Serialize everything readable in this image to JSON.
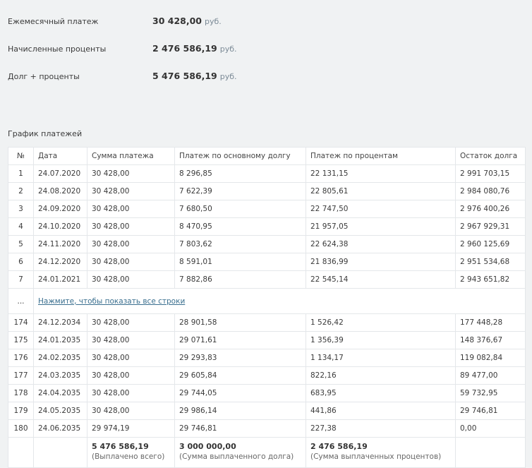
{
  "summary": [
    {
      "label": "Ежемесячный платеж",
      "value": "30 428,00",
      "unit": "руб."
    },
    {
      "label": "Начисленные проценты",
      "value": "2 476 586,19",
      "unit": "руб."
    },
    {
      "label": "Долг + проценты",
      "value": "5 476 586,19",
      "unit": "руб."
    }
  ],
  "schedule": {
    "title": "График платежей",
    "headers": [
      "№",
      "Дата",
      "Сумма платежа",
      "Платеж по основному долгу",
      "Платеж по процентам",
      "Остаток долга"
    ],
    "rows_top": [
      [
        "1",
        "24.07.2020",
        "30 428,00",
        "8 296,85",
        "22 131,15",
        "2 991 703,15"
      ],
      [
        "2",
        "24.08.2020",
        "30 428,00",
        "7 622,39",
        "22 805,61",
        "2 984 080,76"
      ],
      [
        "3",
        "24.09.2020",
        "30 428,00",
        "7 680,50",
        "22 747,50",
        "2 976 400,26"
      ],
      [
        "4",
        "24.10.2020",
        "30 428,00",
        "8 470,95",
        "21 957,05",
        "2 967 929,31"
      ],
      [
        "5",
        "24.11.2020",
        "30 428,00",
        "7 803,62",
        "22 624,38",
        "2 960 125,69"
      ],
      [
        "6",
        "24.12.2020",
        "30 428,00",
        "8 591,01",
        "21 836,99",
        "2 951 534,68"
      ],
      [
        "7",
        "24.01.2021",
        "30 428,00",
        "7 882,86",
        "22 545,14",
        "2 943 651,82"
      ]
    ],
    "ellipsis": "...",
    "show_all_link": "Нажмите, чтобы показать все строки",
    "rows_bottom": [
      [
        "174",
        "24.12.2034",
        "30 428,00",
        "28 901,58",
        "1 526,42",
        "177 448,28"
      ],
      [
        "175",
        "24.01.2035",
        "30 428,00",
        "29 071,61",
        "1 356,39",
        "148 376,67"
      ],
      [
        "176",
        "24.02.2035",
        "30 428,00",
        "29 293,83",
        "1 134,17",
        "119 082,84"
      ],
      [
        "177",
        "24.03.2035",
        "30 428,00",
        "29 605,84",
        "822,16",
        "89 477,00"
      ],
      [
        "178",
        "24.04.2035",
        "30 428,00",
        "29 744,05",
        "683,95",
        "59 732,95"
      ],
      [
        "179",
        "24.05.2035",
        "30 428,00",
        "29 986,14",
        "441,86",
        "29 746,81"
      ],
      [
        "180",
        "24.06.2035",
        "29 974,19",
        "29 746,81",
        "227,38",
        "0,00"
      ]
    ],
    "totals": {
      "payment": {
        "value": "5 476 586,19",
        "label": "(Выплачено всего)"
      },
      "principal": {
        "value": "3 000 000,00",
        "label": "(Сумма выплаченного долга)"
      },
      "interest": {
        "value": "2 476 586,19",
        "label": "(Сумма выплаченных процентов)"
      }
    }
  }
}
